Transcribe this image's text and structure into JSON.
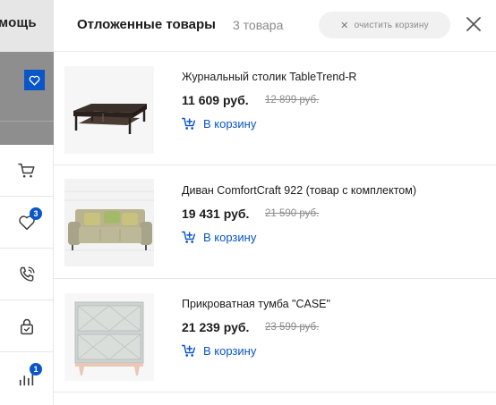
{
  "background": {
    "header_fragment": "мощь"
  },
  "side_toolbar": {
    "favorites_badge": "3",
    "compare_badge": "1"
  },
  "drawer": {
    "title": "Отложенные товары",
    "count": "3 товара",
    "clear_label": "очистить корзину"
  },
  "items": [
    {
      "name": "Журнальный столик TableTrend-R",
      "price": "11 609 руб.",
      "old_price": "12 899 руб.",
      "cart_label": "В корзину"
    },
    {
      "name": "Диван ComfortCraft 922 (товар с комплектом)",
      "price": "19 431 руб.",
      "old_price": "21 590 руб.",
      "cart_label": "В корзину"
    },
    {
      "name": "Прикроватная тумба \"CASE\"",
      "price": "21 239 руб.",
      "old_price": "23 599 руб.",
      "cart_label": "В корзину"
    }
  ],
  "colors": {
    "accent": "#0a55c8",
    "muted": "#8a8a8a"
  }
}
